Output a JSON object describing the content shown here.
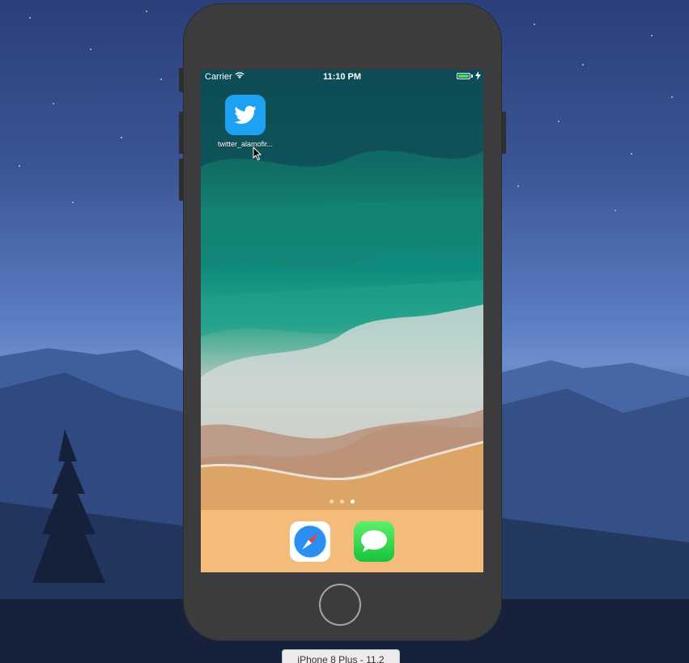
{
  "status_bar": {
    "carrier": "Carrier",
    "time": "11:10 PM"
  },
  "home_screen": {
    "apps": [
      {
        "label": "twitter_alamofir...",
        "icon": "twitter-bird-icon",
        "color": "#1da1f2"
      }
    ],
    "page_dots": {
      "count": 3,
      "active_index": 2
    }
  },
  "dock": {
    "apps": [
      {
        "name": "Safari",
        "icon": "safari-compass-icon"
      },
      {
        "name": "Messages",
        "icon": "messages-bubble-icon"
      }
    ]
  },
  "simulator": {
    "device_label": "iPhone 8 Plus - 11.2"
  },
  "colors": {
    "phone_body": "#3c3c3e",
    "twitter_blue": "#1da1f2",
    "dock": "#f5be7d"
  }
}
